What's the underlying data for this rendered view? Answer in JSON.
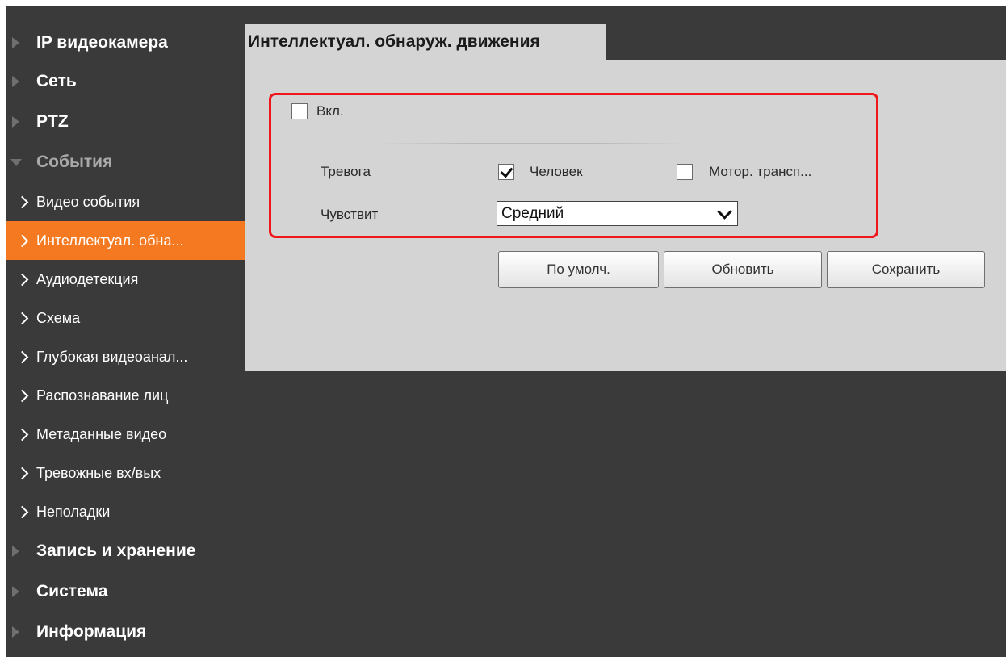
{
  "sidebar": {
    "top_items": [
      {
        "label": "IP видеокамера"
      },
      {
        "label": "Сеть"
      },
      {
        "label": "PTZ"
      },
      {
        "label": "События"
      }
    ],
    "sub_items": [
      {
        "label": "Видео события"
      },
      {
        "label": "Интеллектуал. обна..."
      },
      {
        "label": "Аудиодетекция"
      },
      {
        "label": "Схема"
      },
      {
        "label": "Глубокая видеоанал..."
      },
      {
        "label": "Распознавание лиц"
      },
      {
        "label": "Метаданные видео"
      },
      {
        "label": "Тревожные вх/вых"
      },
      {
        "label": "Неполадки"
      }
    ],
    "bottom_items": [
      {
        "label": "Запись и хранение"
      },
      {
        "label": "Система"
      },
      {
        "label": "Информация"
      }
    ],
    "active_item": "Интеллектуал. обна...",
    "expanded_item": "События"
  },
  "tab": {
    "title": "Интеллектуал. обнаруж. движения"
  },
  "form": {
    "enable": {
      "label": "Вкл.",
      "checked": false
    },
    "alarm": {
      "label": "Тревога",
      "options": [
        {
          "label": "Человек",
          "checked": true
        },
        {
          "label": "Мотор. трансп...",
          "checked": false
        }
      ]
    },
    "sensitivity": {
      "label": "Чувствит",
      "value": "Средний"
    }
  },
  "buttons": {
    "default": "По умолч.",
    "refresh": "Обновить",
    "save": "Сохранить"
  },
  "colors": {
    "active_accent": "#f47920",
    "highlight_box": "#f0161c",
    "panel_bg": "#d4d4d4",
    "frame_bg": "#3a3a3a"
  }
}
